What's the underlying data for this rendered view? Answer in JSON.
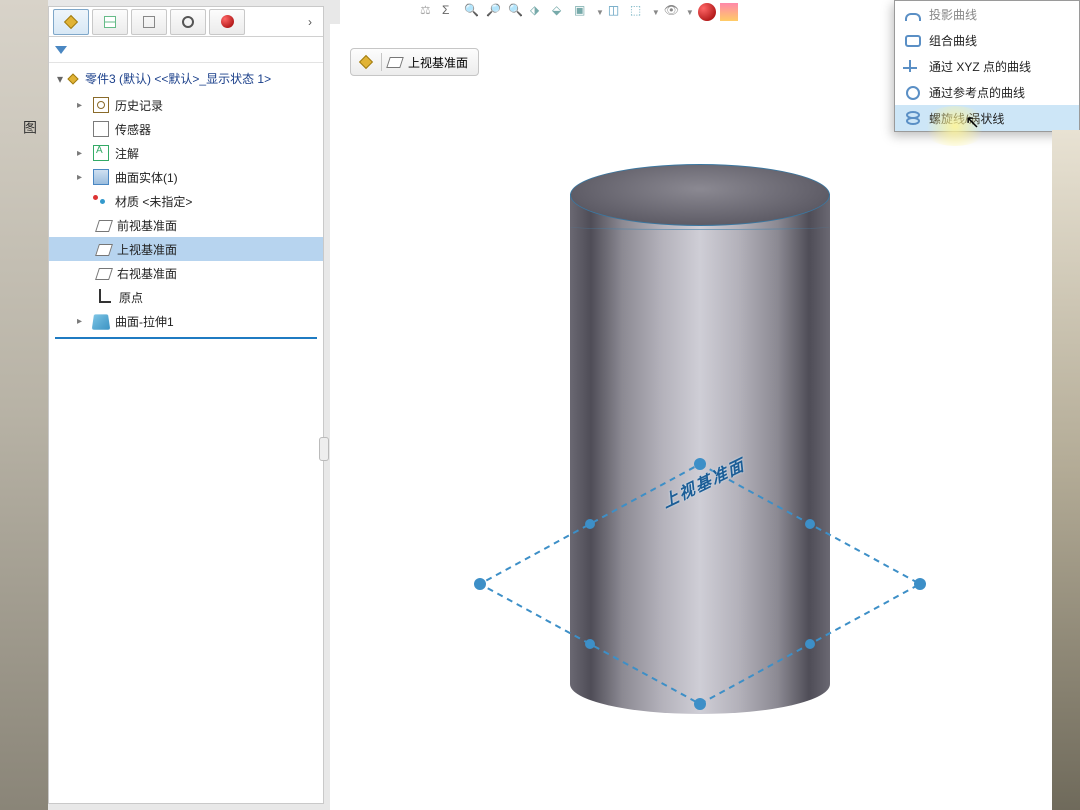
{
  "sidebar_tab_label": "图",
  "tree": {
    "root": "零件3 (默认) <<默认>_显示状态 1>",
    "history": "历史记录",
    "sensor": "传感器",
    "annotation": "注解",
    "surface_body": "曲面实体(1)",
    "material": "材质 <未指定>",
    "front_plane": "前视基准面",
    "top_plane": "上视基准面",
    "right_plane": "右视基准面",
    "origin": "原点",
    "extrude": "曲面-拉伸1"
  },
  "breadcrumb": {
    "plane": "上视基准面"
  },
  "viewport": {
    "plane_label": "上视基准面"
  },
  "context_menu": {
    "items": [
      "投影曲线",
      "组合曲线",
      "通过 XYZ 点的曲线",
      "通过参考点的曲线",
      "螺旋线/涡状线"
    ]
  }
}
